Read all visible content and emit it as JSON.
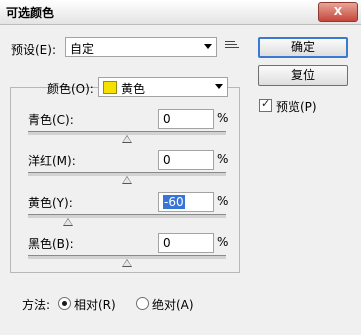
{
  "window": {
    "title": "可选颜色",
    "close": "X"
  },
  "preset": {
    "label": "预设(E):",
    "value": "自定",
    "menu_icon": "menu-lines-icon"
  },
  "buttons": {
    "ok": "确定",
    "reset": "复位"
  },
  "preview": {
    "label": "预览(P)",
    "checked": true,
    "check_glyph": "✓"
  },
  "colors": {
    "label": "颜色(O):",
    "value": "黄色",
    "swatch": "#f5e100"
  },
  "sliders": [
    {
      "label": "青色(C):",
      "value": "0",
      "unit": "%",
      "selected": false
    },
    {
      "label": "洋红(M):",
      "value": "0",
      "unit": "%",
      "selected": false
    },
    {
      "label": "黄色(Y):",
      "value": "-60",
      "unit": "%",
      "selected": true
    },
    {
      "label": "黑色(B):",
      "value": "0",
      "unit": "%",
      "selected": false
    }
  ],
  "method": {
    "label": "方法:",
    "options": [
      {
        "label": "相对(R)",
        "checked": true
      },
      {
        "label": "绝对(A)",
        "checked": false
      }
    ]
  }
}
